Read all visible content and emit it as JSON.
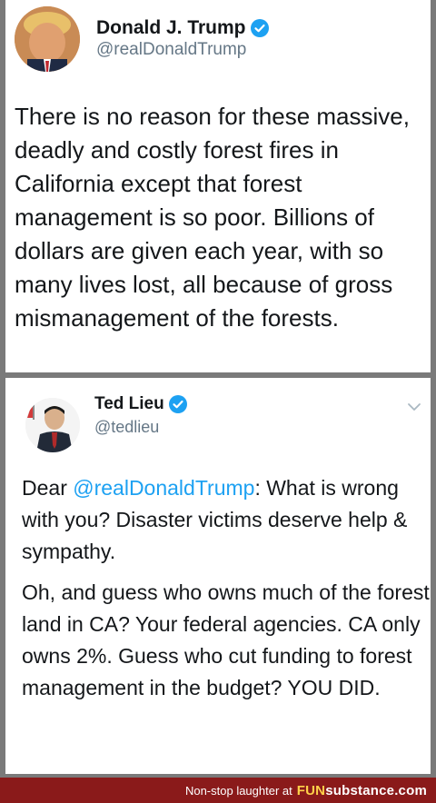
{
  "tweet1": {
    "name": "Donald J. Trump",
    "handle": "@realDonaldTrump",
    "body": "There is no reason for these massive,\ndeadly and costly forest fires in\nCalifornia except that forest\nmanagement is so poor. Billions of\ndollars are given each year, with so\nmany lives lost, all because of gross\nmismanagement of the forests.",
    "verified_icon": "verified-badge-icon",
    "colors": {
      "verified": "#1da1f2",
      "text": "#14171a",
      "handle": "#657786"
    }
  },
  "tweet2": {
    "name": "Ted Lieu",
    "handle": "@tedlieu",
    "p1_prefix": "Dear ",
    "p1_mention": "@realDonaldTrump",
    "p1_suffix": ": What is wrong with you? Disaster victims deserve help & sympathy.",
    "p2": "Oh, and guess who owns much of the forest land in CA? Your federal agencies. CA only owns 2%. Guess who cut funding to forest management in the budget? YOU DID.",
    "verified_icon": "verified-badge-icon",
    "menu_icon": "chevron-down-icon",
    "colors": {
      "mention": "#1da1f2"
    }
  },
  "footer": {
    "tagline": "Non-stop laughter at",
    "brand_fun": "FUN",
    "brand_sub": "substance",
    "brand_com": ".com",
    "colors": {
      "background": "#8a1a1a",
      "accent": "#ffd24a"
    }
  }
}
